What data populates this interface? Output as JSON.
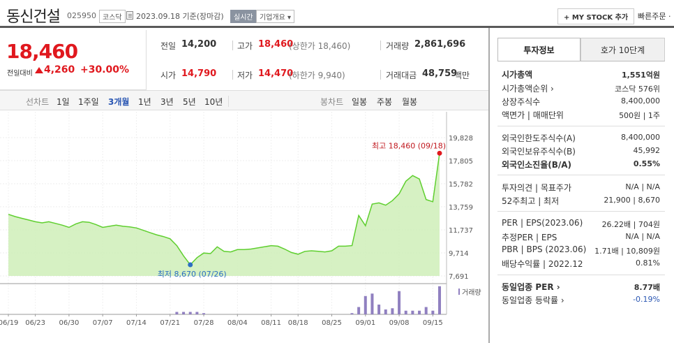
{
  "header": {
    "stock_name": "동신건설",
    "stock_code": "025950",
    "market": "코스닥",
    "date_text": "2023.09.18 기준(장마감)",
    "realtime_badge": "실시간",
    "company_info": "기업개요 ▾",
    "my_stock_button": "+ MY STOCK 추가",
    "quick_order": "빠른주문 ·"
  },
  "price": {
    "current": "18,460",
    "change_label": "전일대비",
    "change_value": "4,260",
    "change_rate": "+30.00%"
  },
  "summary": {
    "prev_close": {
      "label": "전일",
      "value": "14,200"
    },
    "high": {
      "label": "고가",
      "value": "18,460",
      "extra": "(상한가 18,460)"
    },
    "volume": {
      "label": "거래량",
      "value": "2,861,696"
    },
    "open": {
      "label": "시가",
      "value": "14,790"
    },
    "low": {
      "label": "저가",
      "value": "14,470",
      "extra": "(하한가 9,940)"
    },
    "amount": {
      "label": "거래대금",
      "value": "48,759",
      "unit": "백만"
    }
  },
  "period_bar": {
    "line_chart_label": "선차트",
    "periods": [
      "1일",
      "1주일",
      "3개월",
      "1년",
      "3년",
      "5년",
      "10년"
    ],
    "active_period": "3개월",
    "candle_label": "봉차트",
    "candles": [
      "일봉",
      "주봉",
      "월봉"
    ]
  },
  "chart_data": {
    "type": "area",
    "x": [
      "06/19",
      "06/20",
      "06/21",
      "06/22",
      "06/23",
      "06/26",
      "06/27",
      "06/28",
      "06/29",
      "06/30",
      "07/03",
      "07/04",
      "07/05",
      "07/06",
      "07/07",
      "07/10",
      "07/11",
      "07/12",
      "07/13",
      "07/14",
      "07/17",
      "07/18",
      "07/19",
      "07/20",
      "07/21",
      "07/24",
      "07/25",
      "07/26",
      "07/27",
      "07/28",
      "07/31",
      "08/01",
      "08/02",
      "08/03",
      "08/04",
      "08/07",
      "08/08",
      "08/09",
      "08/10",
      "08/11",
      "08/14",
      "08/16",
      "08/17",
      "08/18",
      "08/21",
      "08/22",
      "08/23",
      "08/24",
      "08/25",
      "08/28",
      "08/29",
      "08/30",
      "08/31",
      "09/01",
      "09/04",
      "09/05",
      "09/06",
      "09/07",
      "09/08",
      "09/11",
      "09/12",
      "09/13",
      "09/14",
      "09/15",
      "09/18"
    ],
    "y": [
      13100,
      12900,
      12750,
      12600,
      12450,
      12350,
      12450,
      12300,
      12150,
      11950,
      12250,
      12450,
      12400,
      12200,
      11950,
      12050,
      12150,
      12050,
      12000,
      11900,
      11700,
      11500,
      11300,
      11150,
      10950,
      10350,
      9450,
      8670,
      9300,
      9700,
      9650,
      10250,
      9850,
      9800,
      10000,
      10000,
      10050,
      10150,
      10250,
      10350,
      10300,
      10050,
      9750,
      9600,
      9850,
      9900,
      9850,
      9800,
      9900,
      10300,
      10300,
      10350,
      13000,
      12100,
      14000,
      14100,
      13900,
      14300,
      14900,
      16000,
      16500,
      16200,
      14400,
      14200,
      18460
    ],
    "volume": [
      0,
      0,
      0,
      0,
      0,
      0,
      0,
      0,
      0,
      0,
      0,
      0,
      0,
      0,
      0,
      0,
      0,
      0,
      0,
      0,
      0,
      0,
      0,
      0,
      0,
      1,
      1,
      1,
      1,
      0.5,
      0,
      0,
      0,
      0,
      0,
      0,
      0,
      0,
      0,
      0,
      0,
      0,
      0,
      0,
      0,
      0,
      0,
      0,
      0,
      0,
      0,
      0.5,
      3,
      7.5,
      8.5,
      4,
      2,
      2.5,
      9.5,
      1.5,
      1.5,
      1.5,
      3,
      1.5,
      11.5
    ],
    "y_ticks": [
      "19,828",
      "17,805",
      "15,782",
      "13,759",
      "11,737",
      "9,714",
      "7,691"
    ],
    "ylim": [
      7691,
      19828
    ],
    "x_tick_labels": [
      "06/19",
      "06/23",
      "06/30",
      "07/07",
      "07/14",
      "07/21",
      "07/28",
      "08/04",
      "08/11",
      "08/18",
      "08/25",
      "09/01",
      "09/08",
      "09/15"
    ],
    "max_label": "최고 18,460 (09/18)",
    "min_label": "최저 8,670 (07/26)",
    "volume_legend": "거래량",
    "line_color": "#5fcf2f",
    "fill_color": "#cfeeb8",
    "volume_color": "#9080c0",
    "grid": true
  },
  "right_panel": {
    "tab_invest": "투자정보",
    "tab_hoga": "호가 10단계",
    "rows": [
      {
        "label": "시가총액",
        "value": "1,551억원",
        "bold": true
      },
      {
        "label": "시가총액순위 ›",
        "value": "코스닥 576위"
      },
      {
        "label": "상장주식수",
        "value": "8,400,000"
      },
      {
        "label": "액면가 | 매매단위",
        "value": "500원 | 1주"
      },
      {
        "label": "외국인한도주식수(A)",
        "value": "8,400,000"
      },
      {
        "label": "외국인보유주식수(B)",
        "value": "45,992"
      },
      {
        "label": "외국인소진율(B/A)",
        "value": "0.55%",
        "bold": true
      },
      {
        "label": "투자의견 | 목표주가",
        "value": "N/A | N/A"
      },
      {
        "label": "52주최고 | 최저",
        "value": "21,900 | 8,670"
      },
      {
        "label": "PER | EPS(2023.06)",
        "value": "26.22배 | 704원"
      },
      {
        "label": "추정PER | EPS",
        "value": "N/A | N/A"
      },
      {
        "label": "PBR | BPS (2023.06)",
        "value": "1.71배 | 10,809원"
      },
      {
        "label": "배당수익률 | 2022.12",
        "value": "0.81%"
      },
      {
        "label": "동일업종 PER ›",
        "value": "8.77배",
        "bold": true
      },
      {
        "label": "동일업종 등락률 ›",
        "value": "-0.19%",
        "blue": true
      }
    ]
  }
}
